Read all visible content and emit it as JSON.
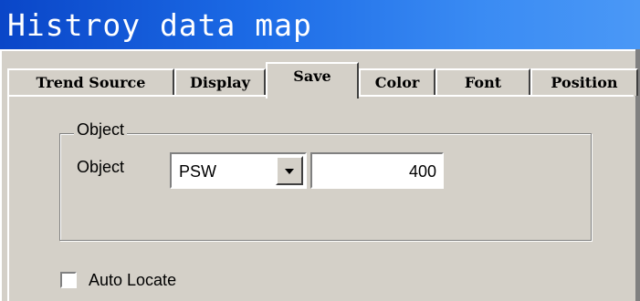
{
  "window": {
    "title": "Histroy data map"
  },
  "tabs": [
    {
      "label": "Trend Source"
    },
    {
      "label": "Display"
    },
    {
      "label": "Save"
    },
    {
      "label": "Color"
    },
    {
      "label": "Font"
    },
    {
      "label": "Position"
    }
  ],
  "active_tab": "Save",
  "group": {
    "legend": "Object",
    "object_label": "Object",
    "combo_value": "PSW",
    "value": "400"
  },
  "auto_locate": {
    "label": "Auto Locate",
    "checked": false
  },
  "icons": {
    "dropdown": "chevron-down-icon"
  }
}
